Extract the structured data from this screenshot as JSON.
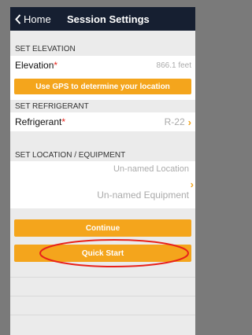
{
  "nav": {
    "back_label": "Home",
    "title": "Session Settings"
  },
  "elevation": {
    "header": "SET ELEVATION",
    "label": "Elevation",
    "required_mark": "*",
    "value": "866.1 feet",
    "gps_button": "Use GPS to determine your location"
  },
  "refrigerant": {
    "header": "SET REFRIGERANT",
    "label": "Refrigerant",
    "required_mark": "*",
    "value": "R-22"
  },
  "location": {
    "header": "SET LOCATION / EQUIPMENT",
    "location_value": "Un-named Location",
    "equipment_value": "Un-named Equipment"
  },
  "actions": {
    "continue_label": "Continue",
    "quick_start_label": "Quick Start"
  },
  "colors": {
    "navbar": "#161f31",
    "accent": "#f4a51c",
    "required": "#e8281e",
    "annotation_circle": "#e8211a"
  }
}
